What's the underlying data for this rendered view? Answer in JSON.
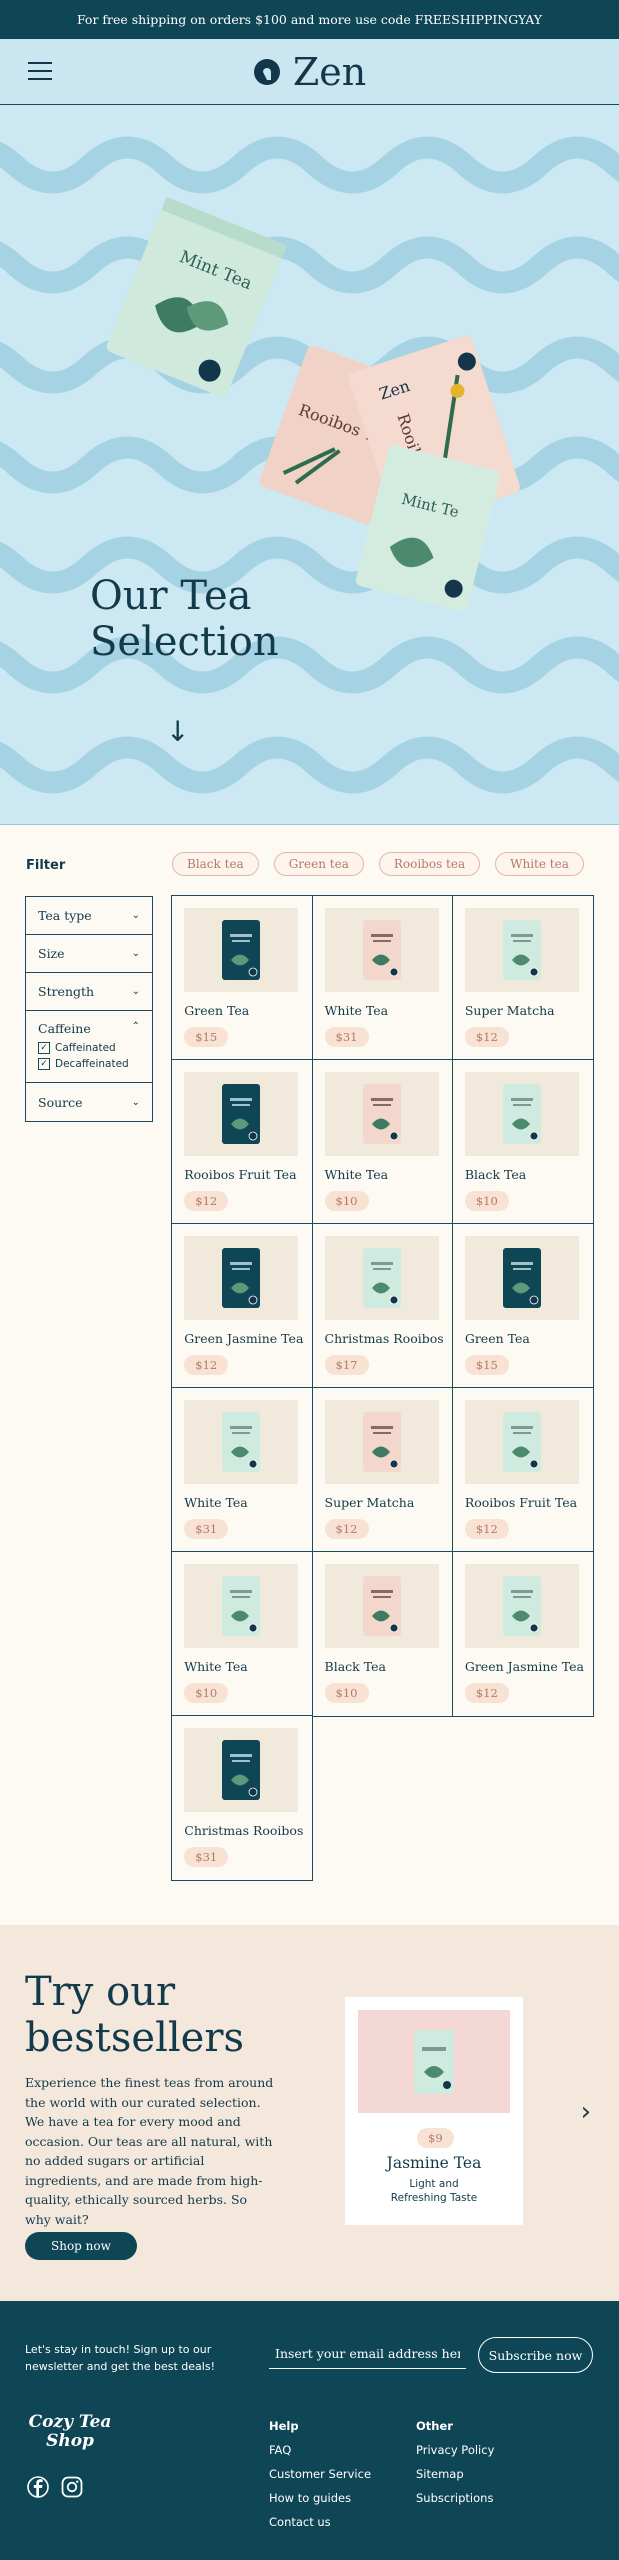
{
  "topbar": {
    "text": "For free shipping on orders $100 and more use code FREESHIPPINGYAY"
  },
  "header": {
    "logo_text": "Zen"
  },
  "hero": {
    "title_line1": "Our Tea",
    "title_line2": "Selection",
    "arrow": "↓",
    "pouch_labels": [
      "Mint Tea",
      "Rooibos Tea",
      "Zen"
    ]
  },
  "filter": {
    "title": "Filter",
    "chips": [
      "Black tea",
      "Green tea",
      "Rooibos tea",
      "White tea"
    ],
    "groups": {
      "tea_type": "Tea type",
      "size": "Size",
      "strength": "Strength",
      "caffeine": "Caffeine",
      "source": "Source"
    },
    "caffeine_options": [
      "Caffeinated",
      "Decaffeinated"
    ],
    "check": "✓"
  },
  "products": [
    {
      "name": "Green Tea",
      "price": "$15",
      "pouch": "dark"
    },
    {
      "name": "White Tea",
      "price": "$31",
      "pouch": "pink"
    },
    {
      "name": "Super Matcha",
      "price": "$12",
      "pouch": "mint"
    },
    {
      "name": "Rooibos Fruit Tea",
      "price": "$12",
      "pouch": "dark"
    },
    {
      "name": "White Tea",
      "price": "$10",
      "pouch": "pink"
    },
    {
      "name": "Black Tea",
      "price": "$10",
      "pouch": "mint"
    },
    {
      "name": "Green Jasmine Tea",
      "price": "$12",
      "pouch": "dark"
    },
    {
      "name": "Christmas Rooibos",
      "price": "$17",
      "pouch": "mint"
    },
    {
      "name": "Green Tea",
      "price": "$15",
      "pouch": "dark"
    },
    {
      "name": "White Tea",
      "price": "$31",
      "pouch": "mint"
    },
    {
      "name": "Super Matcha",
      "price": "$12",
      "pouch": "pink"
    },
    {
      "name": "Rooibos Fruit Tea",
      "price": "$12",
      "pouch": "mint"
    },
    {
      "name": "White Tea",
      "price": "$10",
      "pouch": "mint"
    },
    {
      "name": "Black Tea",
      "price": "$10",
      "pouch": "pink"
    },
    {
      "name": "Green Jasmine Tea",
      "price": "$12",
      "pouch": "mint"
    },
    {
      "name": "Christmas Rooibos",
      "price": "$31",
      "pouch": "dark"
    }
  ],
  "bestsellers": {
    "title_line1": "Try our",
    "title_line2": "bestsellers",
    "text": "Experience the finest teas from around the world with our curated selection. We have a tea for every mood and occasion. Our teas are all natural, with no added sugars or artificial ingredients, and are made from high-quality, ethically sourced herbs. So why wait?",
    "button": "Shop now",
    "featured": {
      "price": "$9",
      "name": "Jasmine Tea",
      "subtitle": "Light and Refreshing Taste"
    },
    "next": "›"
  },
  "footer": {
    "newsletter_text": "Let's stay in touch! Sign up to our newsletter and get the best deals!",
    "email_placeholder": "Insert your email address here",
    "subscribe": "Subscribe now",
    "logo_line1": "Cozy Tea",
    "logo_line2": "Shop",
    "help": {
      "title": "Help",
      "links": [
        "FAQ",
        "Customer Service",
        "How to guides",
        "Contact us"
      ]
    },
    "other": {
      "title": "Other",
      "links": [
        "Privacy Policy",
        "Sitemap",
        "Subscriptions"
      ]
    }
  },
  "colors": {
    "dark": "#0f4656",
    "hero_bg": "#cbe8f3",
    "wave": "#a6d3e4",
    "cream": "#fdf9f3",
    "peach": "#f7e2d4"
  }
}
